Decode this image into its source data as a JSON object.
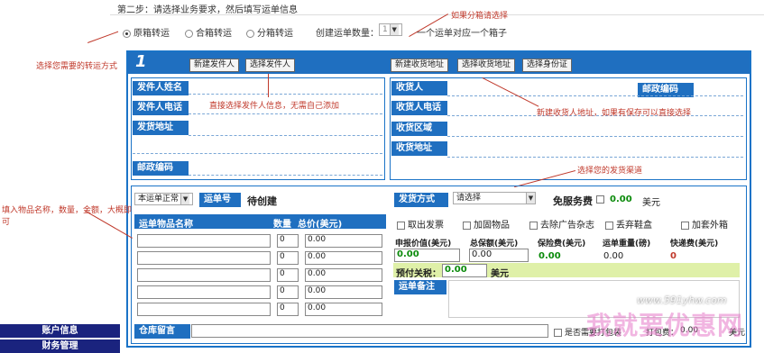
{
  "step_title": "第二步：请选择业务要求，然后填写运单信息",
  "annotations": {
    "split_box": "如果分箱请选择",
    "transit_mode": "选择您需要的转运方式",
    "sender_tip": "直接选择发件人信息，无需自己添加",
    "receiver_tip": "新建收货人地址，如果有保存可以直接选择",
    "channel_tip": "选择您的发货渠道",
    "items_tip": "填入物品名称，数量，金额，大概即可"
  },
  "transit_options": [
    "原箱转运",
    "合箱转运",
    "分箱转运"
  ],
  "waybill_count_label": "创建运单数量：",
  "waybill_count_value": "1",
  "waybill_count_note": "一个运单对应一个箱子",
  "sender": {
    "number": "1",
    "new_btn": "新建发件人",
    "select_btn": "选择发件人",
    "fields": [
      "发件人姓名",
      "发件人电话",
      "发货地址",
      "邮政编码"
    ]
  },
  "receiver": {
    "new_btn": "新建收货地址",
    "select_btn": "选择收货地址",
    "id_btn": "选择身份证",
    "fields": [
      "收货人",
      "收货人电话",
      "收货区域",
      "收货地址"
    ],
    "zip_label": "邮政编码"
  },
  "waybill": {
    "status_select": "本运单正常",
    "number_label": "运单号",
    "number_value": "待创建",
    "items_header": "运单物品名称",
    "qty_header": "数量",
    "total_header": "总价(美元)",
    "rows": [
      {
        "qty": "0",
        "total": "0.00"
      },
      {
        "qty": "0",
        "total": "0.00"
      },
      {
        "qty": "0",
        "total": "0.00"
      },
      {
        "qty": "0",
        "total": "0.00"
      },
      {
        "qty": "0",
        "total": "0.00"
      }
    ]
  },
  "shipping": {
    "method_label": "发货方式",
    "method_value": "请选择",
    "free_service_label": "免服务费",
    "free_service_value": "0.00",
    "free_service_unit": "美元",
    "options": [
      "取出发票",
      "加固物品",
      "去除广告杂志",
      "丢弃鞋盒",
      "加套外箱"
    ],
    "value_labels": [
      "申报价值(美元)",
      "总保额(美元)",
      "保险费(美元)",
      "运单重量(磅)",
      "快递费(美元)"
    ],
    "declared_value": "0.00",
    "insured_value": "0.00",
    "insurance_fee": "0.00",
    "weight": "0.00",
    "express_fee": "0",
    "prepay_label": "预付关税：",
    "prepay_value": "0.00",
    "prepay_unit": "美元",
    "remark_label": "运单备注"
  },
  "bottom": {
    "warehouse_label": "仓库留言",
    "pack_label": "是否需要打包装",
    "pack_fee_label": "打包费：",
    "pack_fee_value": "0.00",
    "pack_fee_unit": "美元"
  },
  "watermark": {
    "url": "www.591yhw.com",
    "text": "我就要优惠网"
  },
  "nav": [
    "账户信息",
    "财务管理"
  ]
}
